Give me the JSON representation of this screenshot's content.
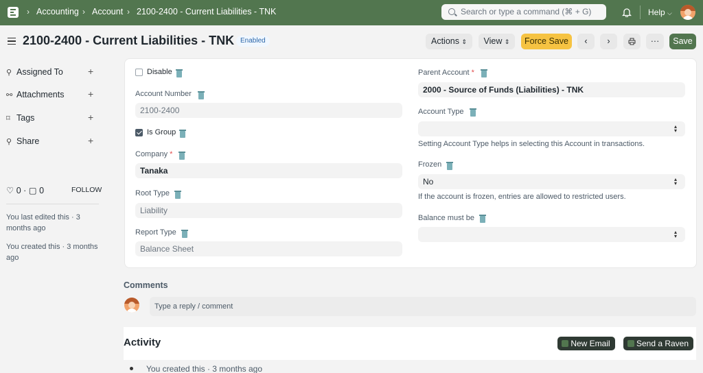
{
  "breadcrumbs": [
    "Accounting",
    "Account",
    "2100-2400 - Current Liabilities - TNK"
  ],
  "search": {
    "placeholder": "Search or type a command (⌘ + G)"
  },
  "help_label": "Help",
  "page": {
    "title": "2100-2400 - Current Liabilities - TNK",
    "status": "Enabled"
  },
  "toolbar": {
    "actions_label": "Actions",
    "view_label": "View",
    "force_save_label": "Force Save",
    "save_label": "Save"
  },
  "sidebar": {
    "items": [
      {
        "label": "Assigned To",
        "icon": "person-icon"
      },
      {
        "label": "Attachments",
        "icon": "paperclip-icon"
      },
      {
        "label": "Tags",
        "icon": "tag-icon"
      },
      {
        "label": "Share",
        "icon": "share-icon"
      }
    ],
    "likes": "0",
    "comments": "0",
    "follow_label": "FOLLOW",
    "edited_text": "You last edited this · 3 months ago",
    "created_text": "You created this · 3 months ago"
  },
  "form": {
    "disable_label": "Disable",
    "account_number_label": "Account Number",
    "account_number_value": "2100-2400",
    "is_group_label": "Is Group",
    "company_label": "Company",
    "company_value": "Tanaka",
    "root_type_label": "Root Type",
    "root_type_value": "Liability",
    "report_type_label": "Report Type",
    "report_type_value": "Balance Sheet",
    "parent_account_label": "Parent Account",
    "parent_account_value": "2000 - Source of Funds (Liabilities) - TNK",
    "account_type_label": "Account Type",
    "account_type_value": "",
    "account_type_help": "Setting Account Type helps in selecting this Account in transactions.",
    "frozen_label": "Frozen",
    "frozen_value": "No",
    "frozen_help": "If the account is frozen, entries are allowed to restricted users.",
    "balance_label": "Balance must be",
    "balance_value": ""
  },
  "comments": {
    "heading": "Comments",
    "placeholder": "Type a reply / comment"
  },
  "activity": {
    "heading": "Activity",
    "new_email_label": "New Email",
    "send_raven_label": "Send a Raven",
    "entry": "You created this · 3 months ago"
  },
  "colors": {
    "navbar": "#52764f",
    "force_save": "#f6c342",
    "save": "#52764f"
  }
}
